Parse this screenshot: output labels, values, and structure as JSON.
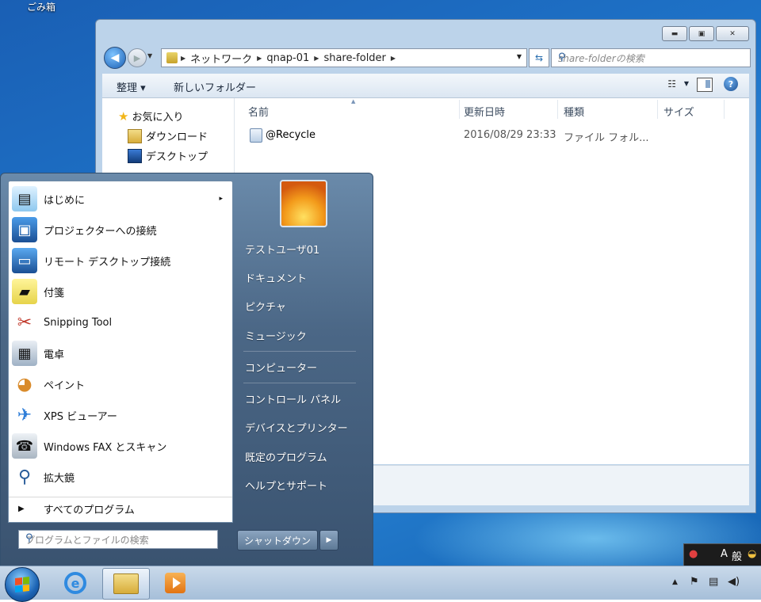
{
  "desktop": {
    "recycle_bin_label": "ごみ箱"
  },
  "explorer": {
    "address": {
      "crumbs": [
        "ネットワーク",
        "qnap-01",
        "share-folder"
      ]
    },
    "search_placeholder": "share-folderの検索",
    "toolbar": {
      "organize": "整理 ▾",
      "new_folder": "新しいフォルダー"
    },
    "nav": [
      {
        "label": "お気に入り",
        "icon": "star-icon"
      },
      {
        "label": "ダウンロード",
        "icon": "download-folder-icon"
      },
      {
        "label": "デスクトップ",
        "icon": "desktop-icon"
      }
    ],
    "columns": [
      "名前",
      "更新日時",
      "種類",
      "サイズ"
    ],
    "files": [
      {
        "name": "@Recycle",
        "modified": "2016/08/29 23:33",
        "type": "ファイル フォル..."
      }
    ]
  },
  "start_menu": {
    "programs": [
      {
        "label": "はじめに",
        "icon": "getting-started-icon",
        "submenu": "▸"
      },
      {
        "label": "プロジェクターへの接続",
        "icon": "projector-icon"
      },
      {
        "label": "リモート デスクトップ接続",
        "icon": "remote-desktop-icon"
      },
      {
        "label": "付箋",
        "icon": "sticky-notes-icon"
      },
      {
        "label": "Snipping Tool",
        "icon": "scissors-icon"
      },
      {
        "label": "電卓",
        "icon": "calculator-icon"
      },
      {
        "label": "ペイント",
        "icon": "paint-palette-icon"
      },
      {
        "label": "XPS ビューアー",
        "icon": "xps-viewer-icon"
      },
      {
        "label": "Windows FAX とスキャン",
        "icon": "fax-icon"
      },
      {
        "label": "拡大鏡",
        "icon": "magnifier-icon"
      }
    ],
    "all_programs": "すべてのプログラム",
    "search_placeholder": "プログラムとファイルの検索",
    "right_items": [
      "テストユーザ01",
      "ドキュメント",
      "ピクチャ",
      "ミュージック",
      "コンピューター",
      "コントロール パネル",
      "デバイスとプリンター",
      "既定のプログラム",
      "ヘルプとサポート"
    ],
    "shutdown": "シャットダウン"
  },
  "ime_bar": {
    "mode": "A",
    "label": "般"
  },
  "colors": {
    "taskbar": "#a6bfd9",
    "startmenu": "#4b6786",
    "accent": "#1a5fb4"
  }
}
